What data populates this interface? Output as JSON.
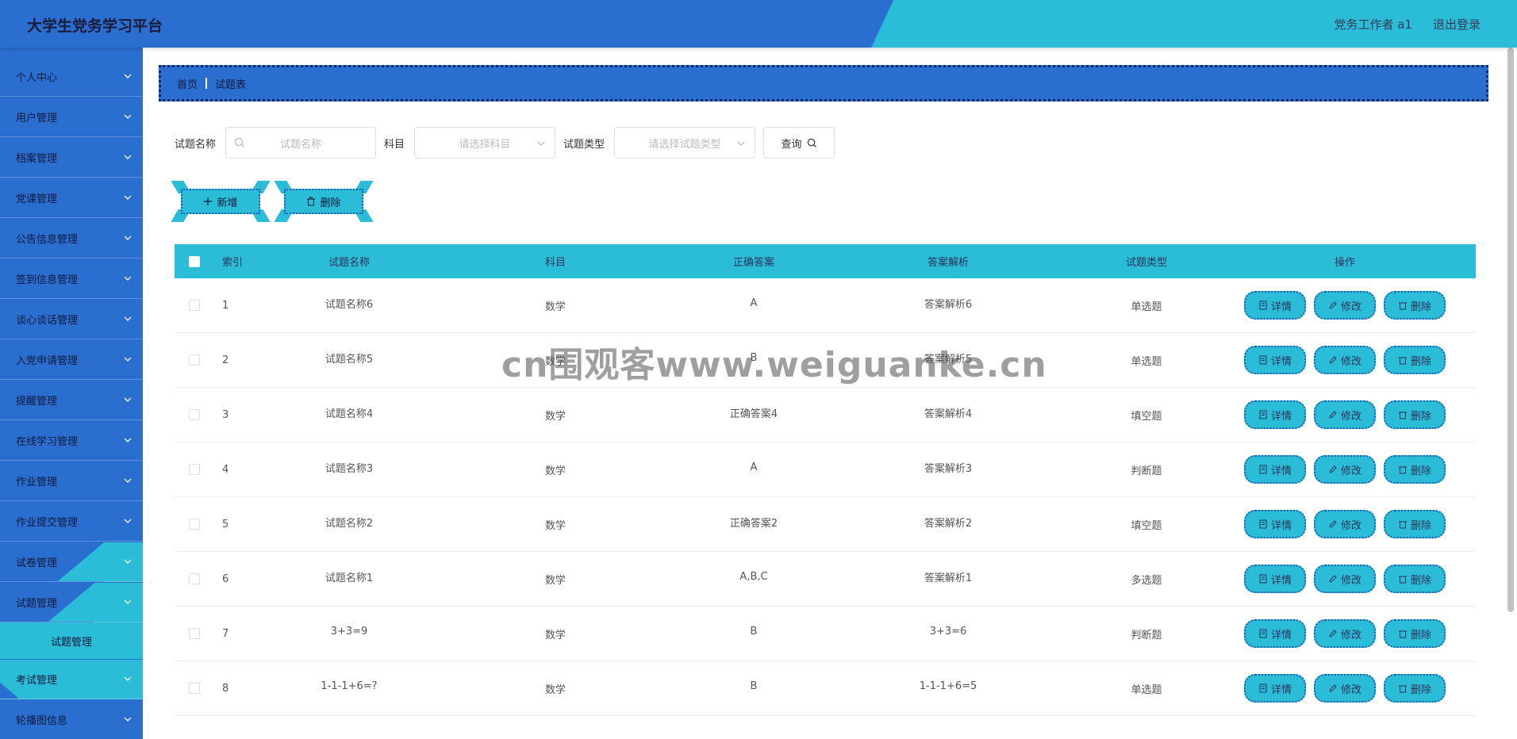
{
  "header": {
    "title": "大学生党务学习平台",
    "user": "党务工作者 a1",
    "logout": "退出登录"
  },
  "sidebar": {
    "items": [
      {
        "label": "个人中心"
      },
      {
        "label": "用户管理"
      },
      {
        "label": "档案管理"
      },
      {
        "label": "党课管理"
      },
      {
        "label": "公告信息管理"
      },
      {
        "label": "签到信息管理"
      },
      {
        "label": "谈心谈话管理"
      },
      {
        "label": "入党申请管理"
      },
      {
        "label": "提醒管理"
      },
      {
        "label": "在线学习管理"
      },
      {
        "label": "作业管理"
      },
      {
        "label": "作业提交管理"
      },
      {
        "label": "试卷管理"
      },
      {
        "label": "试题管理"
      },
      {
        "label": "考试管理"
      },
      {
        "label": "轮播图信息"
      }
    ],
    "sub_item": "试题管理"
  },
  "breadcrumb": {
    "home": "首页",
    "current": "试题表"
  },
  "search": {
    "name_label": "试题名称",
    "name_placeholder": "试题名称",
    "subject_label": "科目",
    "subject_placeholder": "请选择科目",
    "type_label": "试题类型",
    "type_placeholder": "请选择试题类型",
    "query": "查询"
  },
  "actions": {
    "add": "新增",
    "delete": "删除"
  },
  "table": {
    "headers": {
      "index": "索引",
      "name": "试题名称",
      "subject": "科目",
      "answer": "正确答案",
      "explain": "答案解析",
      "type": "试题类型",
      "ops": "操作"
    },
    "ops": {
      "detail": "详情",
      "edit": "修改",
      "delete": "删除"
    },
    "rows": [
      {
        "index": "1",
        "name": "试题名称6",
        "subject": "数学",
        "answer": "A",
        "explain": "答案解析6",
        "type": "单选题"
      },
      {
        "index": "2",
        "name": "试题名称5",
        "subject": "数学",
        "answer": "B",
        "explain": "答案解析5",
        "type": "单选题"
      },
      {
        "index": "3",
        "name": "试题名称4",
        "subject": "数学",
        "answer": "正确答案4",
        "explain": "答案解析4",
        "type": "填空题"
      },
      {
        "index": "4",
        "name": "试题名称3",
        "subject": "数学",
        "answer": "A",
        "explain": "答案解析3",
        "type": "判断题"
      },
      {
        "index": "5",
        "name": "试题名称2",
        "subject": "数学",
        "answer": "正确答案2",
        "explain": "答案解析2",
        "type": "填空题"
      },
      {
        "index": "6",
        "name": "试题名称1",
        "subject": "数学",
        "answer": "A,B,C",
        "explain": "答案解析1",
        "type": "多选题"
      },
      {
        "index": "7",
        "name": "3+3=9",
        "subject": "数学",
        "answer": "B",
        "explain": "3+3=6",
        "type": "判断题"
      },
      {
        "index": "8",
        "name": "1-1-1+6=?",
        "subject": "数学",
        "answer": "B",
        "explain": "1-1-1+6=5",
        "type": "单选题"
      }
    ]
  },
  "watermark": "cn围观客www.weiguanke.cn"
}
